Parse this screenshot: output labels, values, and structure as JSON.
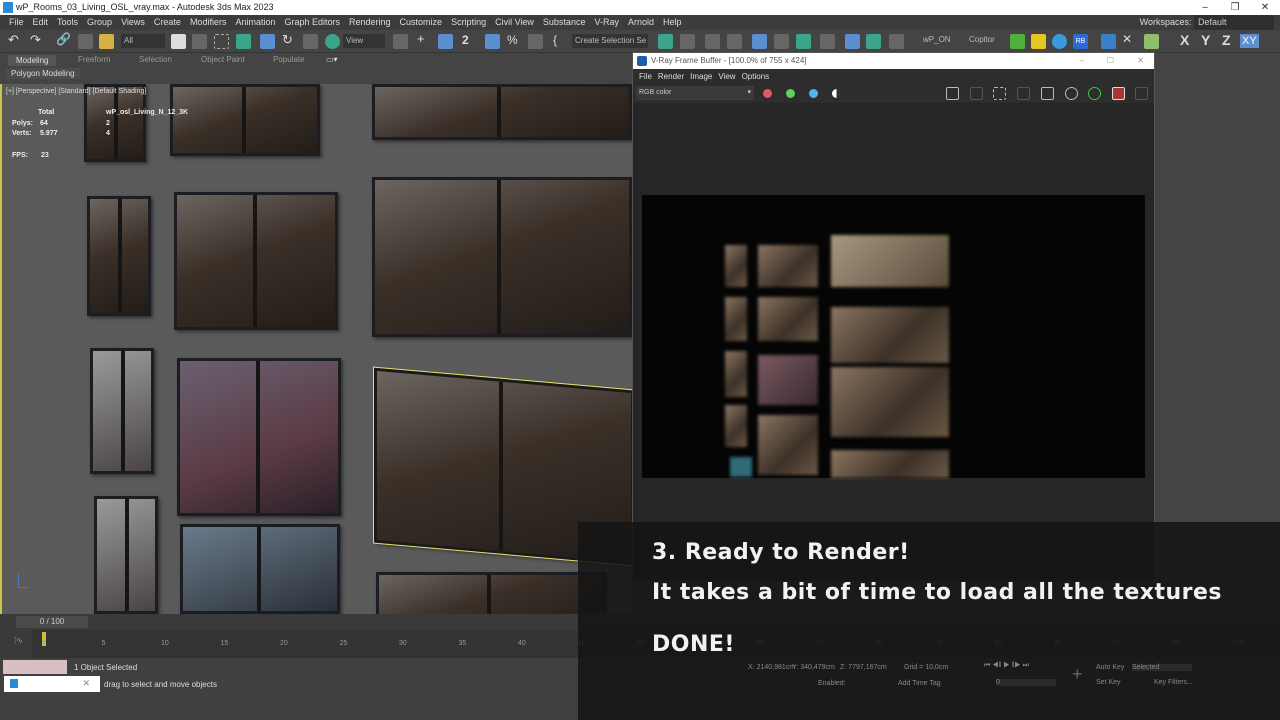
{
  "window": {
    "title": "wP_Rooms_03_Living_OSL_vray.max - Autodesk 3ds Max 2023"
  },
  "menu": [
    "File",
    "Edit",
    "Tools",
    "Group",
    "Views",
    "Create",
    "Modifiers",
    "Animation",
    "Graph Editors",
    "Rendering",
    "Customize",
    "Scripting",
    "Civil View",
    "Substance",
    "V-Ray",
    "Arnold",
    "Help"
  ],
  "workspace": {
    "label": "Workspaces:",
    "value": "Default"
  },
  "toolbar": {
    "selection_filter": "All",
    "ref_coord": "View",
    "named_selection": "Create Selection Se",
    "script_btn1": "wP_ON",
    "script_btn2": "Copitor",
    "axis": [
      "X",
      "Y",
      "Z",
      "XY"
    ]
  },
  "ribbon": {
    "tabs": [
      "Modeling",
      "Freeform",
      "Selection",
      "Object Paint",
      "Populate"
    ],
    "panel": "Polygon Modeling"
  },
  "viewport": {
    "label": "[+] [Perspective] [Standard] [Default Shading]",
    "stats": {
      "total_header": "Total",
      "object_header": "wP_osl_Living_N_12_3K",
      "polys_label": "Polys:",
      "polys_total": "64",
      "polys_obj": "2",
      "verts_label": "Verts:",
      "verts_total": "5.977",
      "verts_obj": "4",
      "fps_label": "FPS:",
      "fps": "23"
    }
  },
  "vfb": {
    "title": "V-Ray Frame Buffer - [100.0% of 755 x 424]",
    "menu": [
      "File",
      "Render",
      "Image",
      "View",
      "Options"
    ],
    "channel": "RGB color",
    "colors": {
      "red": "#e0566a",
      "green": "#5ad45a",
      "blue": "#4fb8e8"
    }
  },
  "timeline": {
    "frame": "0 / 100",
    "ticks": [
      "0",
      "5",
      "10",
      "15",
      "20",
      "25",
      "30",
      "35",
      "40",
      "45",
      "50",
      "55",
      "60",
      "65",
      "70",
      "75",
      "80",
      "85",
      "90",
      "95",
      "100"
    ]
  },
  "status": {
    "selection": "1 Object Selected",
    "prompt": "drag to select and move objects",
    "x": "2140,981cm",
    "y": "340,479cm",
    "z": "7797,167cm",
    "grid": "Grid = 10,0cm",
    "enabled": "Enabled:",
    "add_time_tag": "Add Time Tag",
    "auto_key": "Auto Key",
    "key_mode": "Selected",
    "set_key": "Set Key",
    "key_filters": "Key Filters...",
    "frame_field": "0"
  },
  "caption": {
    "line1": "3. Ready to Render!",
    "line2": "It takes a bit of time to load all the textures",
    "line3": "DONE!"
  }
}
